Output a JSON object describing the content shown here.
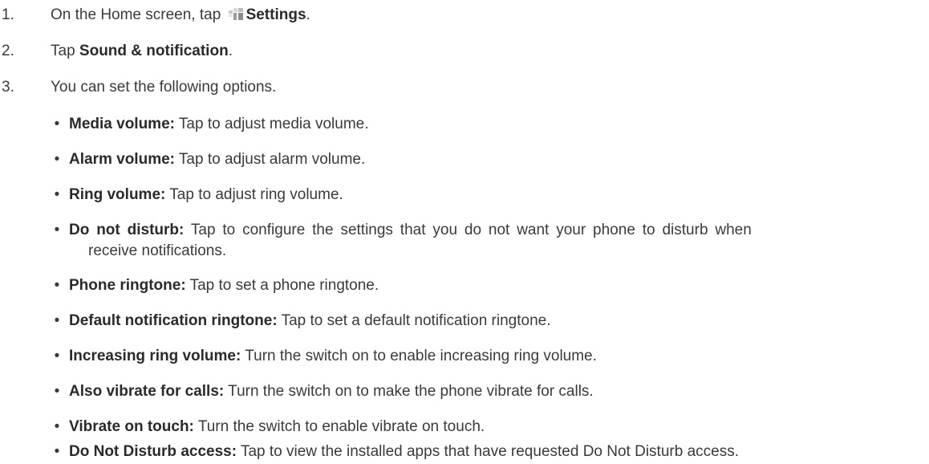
{
  "steps": [
    {
      "num": "1.",
      "pre": "On the Home screen, tap ",
      "icon": "settings-app-icon",
      "bold": "Settings",
      "post": "."
    },
    {
      "num": "2.",
      "pre": "Tap ",
      "bold": "Sound & notification",
      "post": "."
    },
    {
      "num": "3.",
      "text": "You can set the following options."
    }
  ],
  "options": [
    {
      "bold": "Media volume:",
      "text": " Tap to adjust media volume."
    },
    {
      "bold": "Alarm volume:",
      "text": " Tap to adjust alarm volume."
    },
    {
      "bold": "Ring volume:",
      "text": " Tap to adjust ring volume."
    },
    {
      "bold": "Do not disturb:",
      "text": " Tap to configure the settings that you do not want your phone to disturb when",
      "text2": "receive notifications."
    },
    {
      "bold": "Phone ringtone:",
      "text": " Tap to set a phone ringtone."
    },
    {
      "bold": "Default notification ringtone:",
      "text": " Tap to set a default notification ringtone."
    },
    {
      "bold": "Increasing ring volume:",
      "text": " Turn the switch on to enable increasing ring volume."
    },
    {
      "bold": "Also vibrate for calls:",
      "text": " Turn the switch on to make the phone vibrate for calls."
    },
    {
      "bold": "Vibrate on touch:",
      "text": " Turn the switch to enable vibrate on touch."
    },
    {
      "bold": "Do Not Disturb access:",
      "text": " Tap to view the installed apps that have requested Do Not Disturb access."
    }
  ],
  "bullet_char": "•"
}
